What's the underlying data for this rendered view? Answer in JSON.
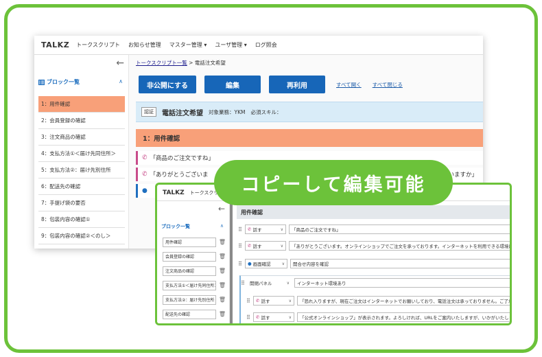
{
  "badge": {
    "text": "コピーして編集可能"
  },
  "back": {
    "nav": {
      "brand": "TALKZ",
      "items": [
        "トークスクリプト",
        "お知らせ管理",
        "マスター管理 ▾",
        "ユーザ管理 ▾",
        "ログ照会"
      ]
    },
    "sidebar": {
      "back_arrow": "←",
      "block_list_label": "ブロック一覧",
      "caret": "∧",
      "items": [
        "1：用件確認",
        "2：会員登録の確認",
        "3：注文商品の確認",
        "4：支払方法①＜届け先同住所＞",
        "5：支払方法②：届け先別住所",
        "6：配送先の確認",
        "7：手提げ袋の要否",
        "8：包装内容の確認①",
        "9：包装内容の確認②＜のし＞"
      ],
      "active_index": 0
    },
    "breadcrumb": {
      "link": "トークスクリプト一覧",
      "sep": ">",
      "current": "電話注文希望"
    },
    "buttons": {
      "unpublish": "非公開にする",
      "edit": "編集",
      "reuse": "再利用",
      "expand_all": "すべて開く",
      "collapse_all": "すべて閉じる"
    },
    "info": {
      "tag": "認証",
      "title": "電話注文希望",
      "target": "対象業務：YKM",
      "skill": "必須スキル："
    },
    "section_title": "1：用件確認",
    "lines": [
      "「商品のご注文ですね」",
      "「ありがとうございま",
      "すいますか」"
    ]
  },
  "front": {
    "nav": {
      "brand": "TALKZ",
      "item": "トークスクリプ"
    },
    "sidebar": {
      "back_arrow": "←",
      "block_list_label": "ブロック一覧",
      "caret": "∧",
      "items": [
        "用件確認",
        "会員登録の確認",
        "注文商品の確認",
        "支払方法①＜届け先同住所＞",
        "支払方法②：届け先別住所",
        "配送先の確認"
      ]
    },
    "section_title": "用件確認",
    "rows": [
      {
        "type": "話す",
        "text": "「商品のご注文ですね」"
      },
      {
        "type": "話す",
        "text": "「ありがとうございます。オンラインショップでご注文を承っております。インターネットを利用できる環境はございますか」"
      },
      {
        "type": "画面確認",
        "text": "開合せ内容を確認"
      },
      {
        "type": "開閉パネル",
        "text": "インターネット環境あり"
      },
      {
        "type": "話す",
        "text": "「恐れ入りますが、現在ご注文はインターネットでお願いしており、電話注文は承っておりません。ご了承ください。」"
      },
      {
        "type": "話す",
        "text": "「公式オンラインショップ」が表示されます。よろしければ、URLをご案内いたしますが、いかがいたしましょうか？」"
      }
    ]
  }
}
